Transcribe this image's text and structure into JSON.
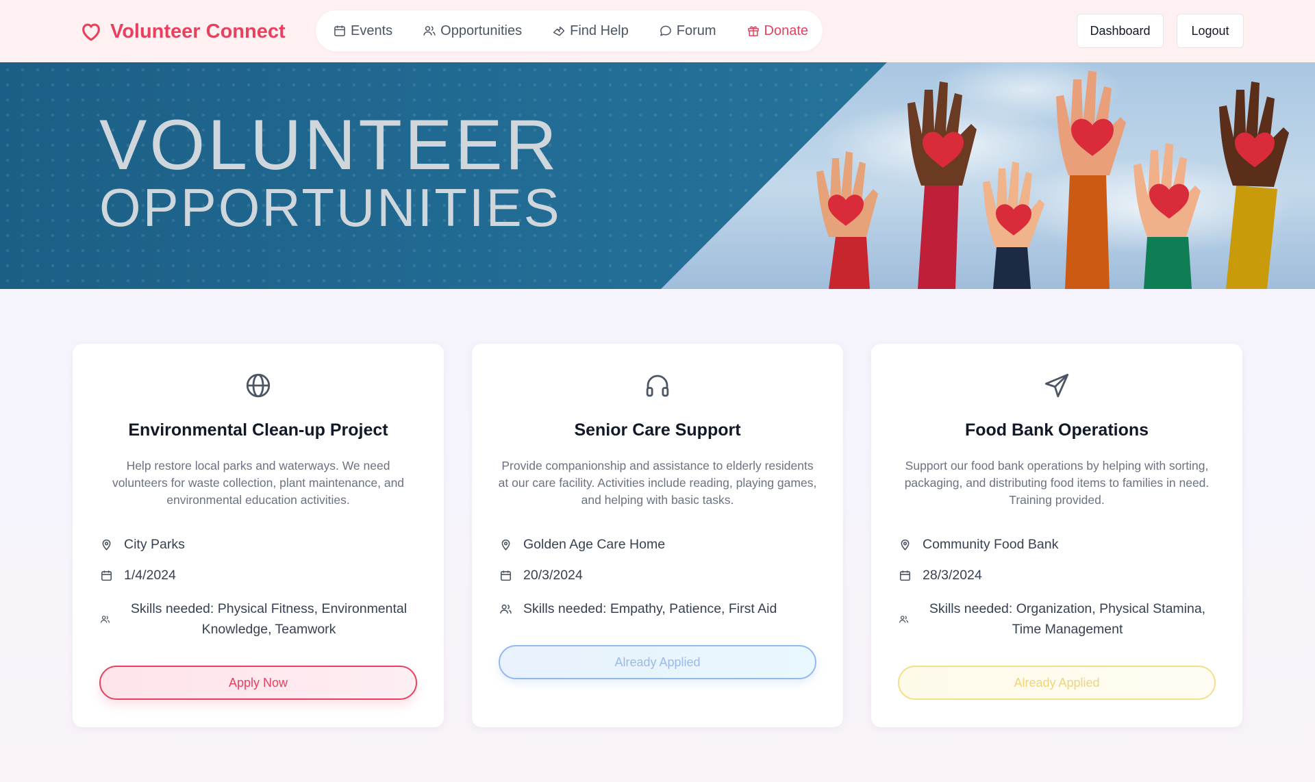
{
  "brand": {
    "name": "Volunteer Connect",
    "icon": "heart-icon",
    "color": "#e8405e"
  },
  "nav": {
    "items": [
      {
        "label": "Events",
        "icon": "calendar-icon"
      },
      {
        "label": "Opportunities",
        "icon": "users-icon"
      },
      {
        "label": "Find Help",
        "icon": "hand-heart-icon"
      },
      {
        "label": "Forum",
        "icon": "chat-bubble-icon"
      },
      {
        "label": "Donate",
        "icon": "gift-icon"
      }
    ]
  },
  "header_buttons": {
    "dashboard": "Dashboard",
    "logout": "Logout"
  },
  "hero": {
    "line1": "VOLUNTEER",
    "line2": "OPPORTUNITIES"
  },
  "cards": [
    {
      "icon": "globe-icon",
      "title": "Environmental Clean-up Project",
      "description": "Help restore local parks and waterways. We need volunteers for waste collection, plant maintenance, and environmental education activities.",
      "location": "City Parks",
      "date": "1/4/2024",
      "skills": "Skills needed: Physical Fitness, Environmental Knowledge, Teamwork",
      "button": "Apply Now"
    },
    {
      "icon": "headphones-icon",
      "title": "Senior Care Support",
      "description": "Provide companionship and assistance to elderly residents at our care facility. Activities include reading, playing games, and helping with basic tasks.",
      "location": "Golden Age Care Home",
      "date": "20/3/2024",
      "skills": "Skills needed: Empathy, Patience, First Aid",
      "button": "Already Applied"
    },
    {
      "icon": "send-icon",
      "title": "Food Bank Operations",
      "description": "Support our food bank operations by helping with sorting, packaging, and distributing food items to families in need. Training provided.",
      "location": "Community Food Bank",
      "date": "28/3/2024",
      "skills": "Skills needed: Organization, Physical Stamina, Time Management",
      "button": "Already Applied"
    }
  ]
}
